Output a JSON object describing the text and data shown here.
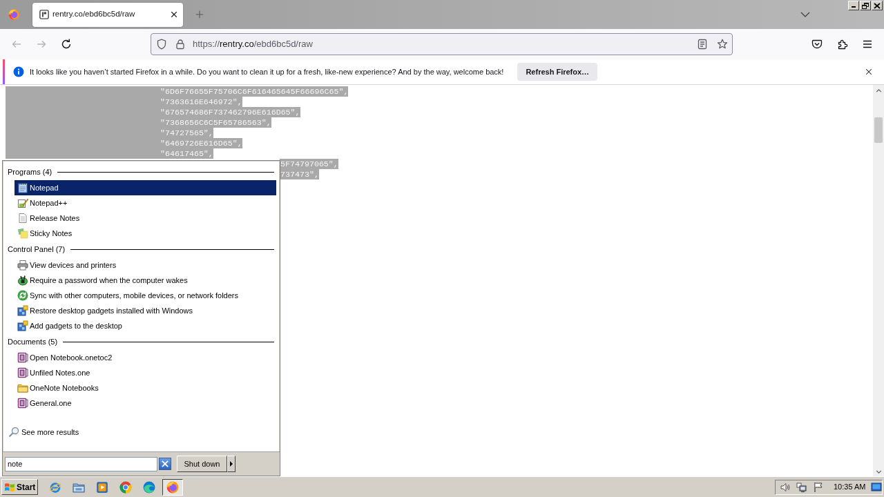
{
  "browser": {
    "tabs": [
      {
        "title": "rentry.co/ebd6bc5d/raw",
        "selected": true
      }
    ],
    "nav": [
      {
        "kind": "back",
        "disabled": true
      },
      {
        "kind": "forward",
        "disabled": true
      },
      {
        "kind": "reload",
        "disabled": false
      }
    ],
    "address": {
      "scheme": "https://",
      "host": "rentry.co",
      "path": "/ebd6bc5d/raw"
    },
    "notification": {
      "message": "It looks like you haven’t started Firefox in a while. Do you want to clean it up for a fresh, like-new experience? And by the way, welcome back!",
      "button": "Refresh Firefox…"
    }
  },
  "page": {
    "lines": [
      {
        "text": "\"6D6F76655F75706C6F616465645F66696C65\",",
        "selected": true
      },
      {
        "text": "\"7363616E646972\",",
        "selected": true
      },
      {
        "text": "\"676574686F737462796E616D65\",",
        "selected": true
      },
      {
        "text": "\"7368656C6C5F65786563\",",
        "selected": true
      },
      {
        "text": "\"74727565\",",
        "selected": true
      },
      {
        "text": "\"6469726E616D65\",",
        "selected": true
      },
      {
        "text": "\"64617465\",",
        "selected": true
      }
    ],
    "lines_behind_menu": [
      {
        "text": "5F74797065\",",
        "selected": true
      },
      {
        "text": "737473\",",
        "selected": true
      }
    ]
  },
  "start_menu": {
    "groups": [
      {
        "title": "Programs (4)",
        "items": [
          {
            "label": "Notepad",
            "kind": "notepad",
            "selected": true
          },
          {
            "label": "Notepad++",
            "kind": "editor",
            "selected": false
          },
          {
            "label": "Release Notes",
            "kind": "textfile",
            "selected": false
          },
          {
            "label": "Sticky Notes",
            "kind": "sticky",
            "selected": false
          }
        ]
      },
      {
        "title": "Control Panel (7)",
        "items": [
          {
            "label": "View devices and printers",
            "kind": "printer",
            "selected": false
          },
          {
            "label": "Require a password when the computer wakes",
            "kind": "plug",
            "selected": false
          },
          {
            "label": "Sync with other computers, mobile devices, or network folders",
            "kind": "sync",
            "selected": false
          },
          {
            "label": "Restore desktop gadgets installed with Windows",
            "kind": "gadget",
            "selected": false
          },
          {
            "label": "Add gadgets to the desktop",
            "kind": "gadget",
            "selected": false
          }
        ]
      },
      {
        "title": "Documents (5)",
        "items": [
          {
            "label": "Open Notebook.onetoc2",
            "kind": "notebook",
            "selected": false
          },
          {
            "label": "Unfiled Notes.one",
            "kind": "notebook",
            "selected": false
          },
          {
            "label": "OneNote Notebooks",
            "kind": "folder",
            "selected": false
          },
          {
            "label": "General.one",
            "kind": "notebook",
            "selected": false
          }
        ]
      }
    ],
    "see_more": "See more results",
    "search": {
      "value": "note"
    },
    "shut_down": "Shut down"
  },
  "taskbar": {
    "start": "Start",
    "items": [
      {
        "kind": "ie",
        "active": false
      },
      {
        "kind": "explorer",
        "active": false
      },
      {
        "kind": "media",
        "active": false
      },
      {
        "kind": "chrome",
        "active": false
      },
      {
        "kind": "edge",
        "active": false
      },
      {
        "kind": "firefox",
        "active": true
      }
    ],
    "clock": "10:35 AM"
  }
}
